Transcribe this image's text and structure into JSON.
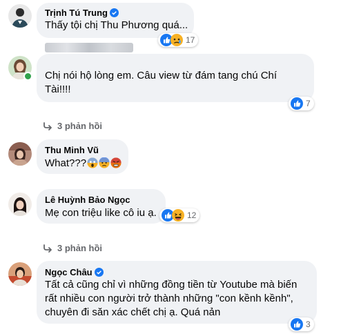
{
  "comments": [
    {
      "name": "Trịnh Tú Trung",
      "verified": true,
      "text": "Thấy tội chị Thu Phương quá...",
      "reactions": {
        "icons": [
          "like-icon",
          "sad-icon"
        ],
        "count": "17"
      }
    },
    {
      "name": "",
      "name_hidden": true,
      "online": true,
      "text_lines": [
        "Chị nói hộ lòng em. Câu view từ đám tang chú Chí",
        "Tài!!!!"
      ],
      "reactions": {
        "icons": [
          "like-icon"
        ],
        "count": "7"
      },
      "replies": "3 phản hồi"
    },
    {
      "name": "Thu Minh Vũ",
      "text": "What???",
      "text_emojis": [
        "screaming-emoji",
        "anxious-emoji",
        "angry-emoji"
      ]
    },
    {
      "name": "Lê Huỳnh Bảo Ngọc",
      "text": "Mẹ con triệu like cô iu ạ.",
      "reactions": {
        "icons": [
          "like-icon",
          "haha-icon"
        ],
        "count": "12"
      },
      "replies": "3 phản hồi"
    },
    {
      "name": "Ngọc Châu",
      "verified": true,
      "text_lines": [
        "Tất cả cũng chỉ vì những đồng tiền từ Youtube mà biến",
        "rất nhiều con người trở thành những \"con kềnh kềnh\",",
        "chuyên đi săn xác chết chị ạ. Quá nản"
      ],
      "reactions": {
        "icons": [
          "like-icon"
        ],
        "count": "3"
      }
    }
  ],
  "colors": {
    "bubble": "#f0f2f5",
    "verified": "#1877f2",
    "like": "#1877f2",
    "secondary_text": "#65676b",
    "online": "#31a24c"
  }
}
